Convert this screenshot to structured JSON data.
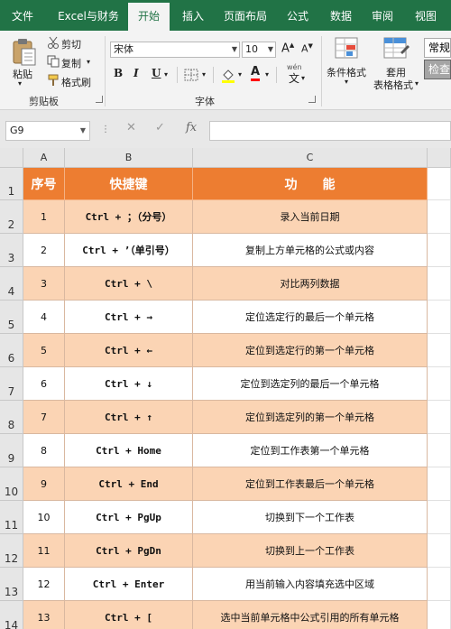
{
  "tabs": [
    "文件",
    "Excel与财务",
    "开始",
    "插入",
    "页面布局",
    "公式",
    "数据",
    "审阅",
    "视图"
  ],
  "clipboard": {
    "paste": "粘贴",
    "cut": "剪切",
    "copy": "复制",
    "format_painter": "格式刷",
    "group": "剪贴板"
  },
  "font": {
    "name": "宋体",
    "size": "10",
    "bold": "B",
    "italic": "I",
    "underline": "U",
    "wen": "wén",
    "wen_char": "文",
    "group": "字体"
  },
  "styles": {
    "conditional": "条件格式",
    "table_format_1": "套用",
    "table_format_2": "表格格式",
    "cell_style_1": "常规",
    "cell_style_2": "检查"
  },
  "name_box": "G9",
  "fx": "fx",
  "columns": [
    "A",
    "B",
    "C"
  ],
  "header": {
    "a": "序号",
    "b": "快捷键",
    "c": "功　　能"
  },
  "rows": [
    {
      "rownum": "2",
      "num": "1",
      "key": "Ctrl + ；（分号）",
      "func": "录入当前日期"
    },
    {
      "rownum": "3",
      "num": "2",
      "key": "Ctrl + ’（单引号）",
      "func": "复制上方单元格的公式或内容"
    },
    {
      "rownum": "4",
      "num": "3",
      "key": "Ctrl + \\",
      "func": "对比两列数据"
    },
    {
      "rownum": "5",
      "num": "4",
      "key": "Ctrl + →",
      "func": "定位选定行的最后一个单元格"
    },
    {
      "rownum": "6",
      "num": "5",
      "key": "Ctrl + ←",
      "func": "定位到选定行的第一个单元格"
    },
    {
      "rownum": "7",
      "num": "6",
      "key": "Ctrl + ↓",
      "func": "定位到选定列的最后一个单元格"
    },
    {
      "rownum": "8",
      "num": "7",
      "key": "Ctrl + ↑",
      "func": "定位到选定列的第一个单元格"
    },
    {
      "rownum": "9",
      "num": "8",
      "key": "Ctrl + Home",
      "func": "定位到工作表第一个单元格"
    },
    {
      "rownum": "10",
      "num": "9",
      "key": "Ctrl + End",
      "func": "定位到工作表最后一个单元格"
    },
    {
      "rownum": "11",
      "num": "10",
      "key": "Ctrl + PgUp",
      "func": "切换到下一个工作表"
    },
    {
      "rownum": "12",
      "num": "11",
      "key": "Ctrl + PgDn",
      "func": "切换到上一个工作表"
    },
    {
      "rownum": "13",
      "num": "12",
      "key": "Ctrl + Enter",
      "func": "用当前输入内容填充选中区域"
    },
    {
      "rownum": "14",
      "num": "13",
      "key": "Ctrl + [",
      "func": "选中当前单元格中公式引用的所有单元格"
    }
  ],
  "header_rownum": "1",
  "colors": {
    "ribbon_green": "#217346",
    "header_orange": "#ed7d31",
    "row_peach": "#fbd4b4"
  }
}
